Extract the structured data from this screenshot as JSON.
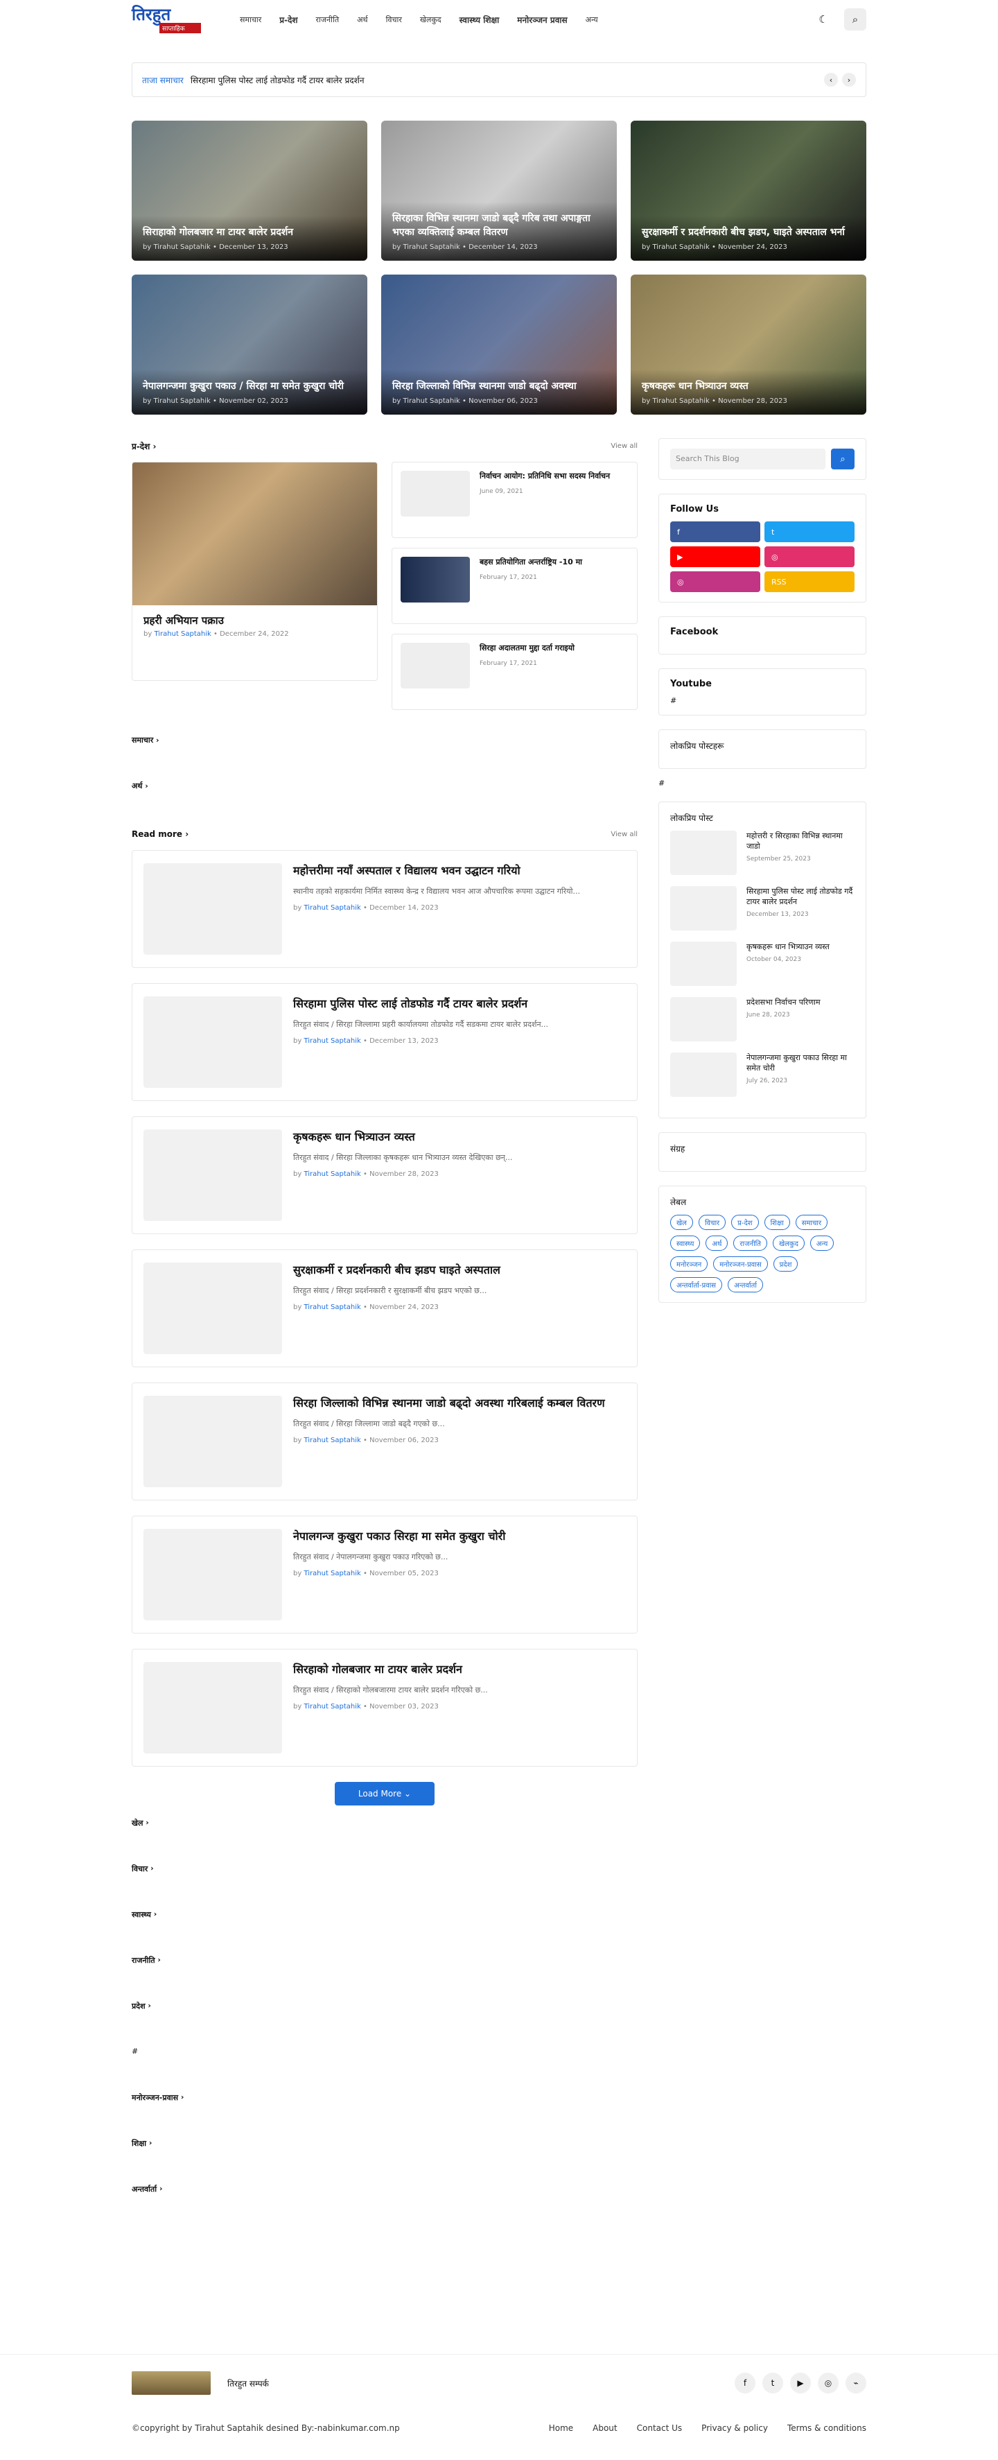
{
  "header": {
    "logo_main": "तिरहुत",
    "logo_sub": "साप्ताहिक",
    "nav": [
      "समाचार",
      "प्र-देश",
      "राजनीति",
      "अर्थ",
      "विचार",
      "खेलकुद",
      "स्वास्थ्य शिक्षा",
      "मनोरञ्जन प्रवास",
      "अन्य"
    ],
    "dark_mode_icon": "☾",
    "search_icon": "⌕"
  },
  "ticker": {
    "label": "ताजा समाचार",
    "text": "सिरहामा पुलिस पोस्ट लाई तोडफोड गर्दै टायर बालेर प्रदर्शन"
  },
  "featured": [
    {
      "title": "सिराहाको गोलबजार मा टायर बालेर प्रदर्शन",
      "author": "by Tirahut Saptahik",
      "date": "December 13, 2023"
    },
    {
      "title": "सिरहाका विभिन्न स्थानमा जाडो बढ्दै गरिब तथा अपाङ्गता भएका व्यक्तिलाई कम्बल वितरण",
      "author": "by Tirahut Saptahik",
      "date": "December 14, 2023"
    },
    {
      "title": "सुरक्षाकर्मी र प्रदर्शनकारी बीच झडप, घाइते अस्पताल भर्ना",
      "author": "by Tirahut Saptahik",
      "date": "November 24, 2023"
    },
    {
      "title": "नेपालगन्जमा कुखुरा पकाउ / सिरहा मा समेत कुखुरा चोरी",
      "author": "by Tirahut Saptahik",
      "date": "November 02, 2023"
    },
    {
      "title": "सिरहा जिल्लाको विभिन्न स्थानमा जाडो बढ्दो अवस्था",
      "author": "by Tirahut Saptahik",
      "date": "November 06, 2023"
    },
    {
      "title": "कृषकहरू धान भित्र्याउन व्यस्त",
      "author": "by Tirahut Saptahik",
      "date": "November 28, 2023"
    }
  ],
  "section_desh": {
    "title": "प्र-देश",
    "view_all": "View all",
    "big": {
      "title": "प्रहरी अभियान पक्राउ",
      "author": "Tirahut Saptahik",
      "date": "December 24, 2022"
    },
    "small": [
      {
        "title": "निर्वाचन आयोग: प्रतिनिधि सभा सदस्य निर्वाचन",
        "date": "June 09, 2021"
      },
      {
        "title": "बहस प्रतियोगिता अन्तर्राष्ट्रिय -10 मा",
        "date": "February 17, 2021"
      },
      {
        "title": "सिरहा अदालतमा मुद्दा दर्ता गराइयो",
        "date": "February 17, 2021"
      }
    ]
  },
  "cat_label_1": "समाचार",
  "cat_label_2": "अर्थ",
  "read_more": {
    "title": "Read more",
    "view_all": "View all"
  },
  "posts": [
    {
      "title": "महोत्तरीमा नयाँ अस्पताल र विद्यालय भवन उद्घाटन गरियो",
      "snippet": "स्थानीय तहको सहकार्यमा निर्मित स्वास्थ्य केन्द्र र विद्यालय भवन आज औपचारिक रूपमा उद्घाटन गरियो...",
      "author": "Tirahut Saptahik",
      "date": "December 14, 2023"
    },
    {
      "title": "सिरहामा पुलिस पोस्ट लाई तोडफोड गर्दै टायर बालेर प्रदर्शन",
      "snippet": "तिरहुत संवाद / सिरहा जिल्लामा प्रहरी कार्यालयमा तोडफोड गर्दै सडकमा टायर बालेर प्रदर्शन...",
      "author": "Tirahut Saptahik",
      "date": "December 13, 2023"
    },
    {
      "title": "कृषकहरू धान भित्र्याउन व्यस्त",
      "snippet": "तिरहुत संवाद / सिरहा जिल्लाका कृषकहरू धान भित्र्याउन व्यस्त देखिएका छन्...",
      "author": "Tirahut Saptahik",
      "date": "November 28, 2023"
    },
    {
      "title": "सुरक्षाकर्मी र प्रदर्शनकारी बीच झडप घाइते अस्पताल",
      "snippet": "तिरहुत संवाद / सिरहा प्रदर्शनकारी र सुरक्षाकर्मी बीच झडप भएको छ...",
      "author": "Tirahut Saptahik",
      "date": "November 24, 2023"
    },
    {
      "title": "सिरहा जिल्लाको विभिन्न स्थानमा जाडो बढ्दो अवस्था गरिबलाई कम्बल वितरण",
      "snippet": "तिरहुत संवाद / सिरहा जिल्लामा जाडो बढ्दै गएको छ...",
      "author": "Tirahut Saptahik",
      "date": "November 06, 2023"
    },
    {
      "title": "नेपालगन्ज कुखुरा पकाउ सिरहा मा समेत कुखुरा चोरी",
      "snippet": "तिरहुत संवाद / नेपालगन्जमा कुखुरा पकाउ गरिएको छ...",
      "author": "Tirahut Saptahik",
      "date": "November 05, 2023"
    },
    {
      "title": "सिरहाको गोलबजार मा टायर बालेर प्रदर्शन",
      "snippet": "तिरहुत संवाद / सिरहाको गोलबजारमा टायर बालेर प्रदर्शन गरिएको छ...",
      "author": "Tirahut Saptahik",
      "date": "November 03, 2023"
    }
  ],
  "load_more": "Load More",
  "cat_links": [
    "खेल",
    "विचार",
    "स्वास्थ्य",
    "राजनीति",
    "प्रदेश",
    "#",
    "मनोरञ्जन-प्रवास",
    "शिक्षा",
    "अन्तर्वार्ता"
  ],
  "sidebar": {
    "search_placeholder": "Search This Blog",
    "follow_title": "Follow Us",
    "follow": [
      {
        "label": "f",
        "color": "#3b5998"
      },
      {
        "label": "t",
        "color": "#1da1f2"
      },
      {
        "label": "▶",
        "color": "#ff0000"
      },
      {
        "label": "◎",
        "color": "#e1306c"
      },
      {
        "label": "◎",
        "color": "#c13584"
      },
      {
        "label": "RSS",
        "color": "#f7b500"
      }
    ],
    "facebook": "Facebook",
    "youtube": "Youtube",
    "youtube_hash": "#",
    "w_stats": "लोकप्रिय पोस्टहरू",
    "w_hash": "#",
    "popular_title": "लोकप्रिय पोस्ट",
    "popular": [
      {
        "title": "महोत्तरी र सिरहाका विभिन्न स्थानमा जाडो",
        "date": "September 25, 2023"
      },
      {
        "title": "सिरहामा पुलिस पोस्ट लाई तोडफोड गर्दै टायर बालेर प्रदर्शन",
        "date": "December 13, 2023"
      },
      {
        "title": "कृषकहरू धान भित्र्याउन व्यस्त",
        "date": "October 04, 2023"
      },
      {
        "title": "प्रदेशसभा निर्वाचन परिणाम",
        "date": "June 28, 2023"
      },
      {
        "title": "नेपालगन्जमा कुखुरा पकाउ सिरहा मा समेत चोरी",
        "date": "July 26, 2023"
      }
    ],
    "archive_title": "संग्रह",
    "labels_title": "लेबल",
    "tags": [
      "खेल",
      "विचार",
      "प्र-देश",
      "शिक्षा",
      "समाचार",
      "स्वास्थ्य",
      "अर्थ",
      "राजनीति",
      "खेलकुद",
      "अन्य",
      "मनोरञ्जन",
      "मनोरञ्जन-प्रवास",
      "प्रदेश",
      "अन्तर्वार्ता-प्रवास",
      "अन्तर्वार्ता"
    ]
  },
  "footer": {
    "text": "तिरहुत सम्पर्क",
    "icons": [
      "f",
      "t",
      "▶",
      "◎",
      "⌁"
    ],
    "copyright": "©copyright by Tirahut Saptahik desined By:-nabinkumar.com.np",
    "links": [
      "Home",
      "About",
      "Contact Us",
      "Privacy & policy",
      "Terms & conditions"
    ]
  }
}
